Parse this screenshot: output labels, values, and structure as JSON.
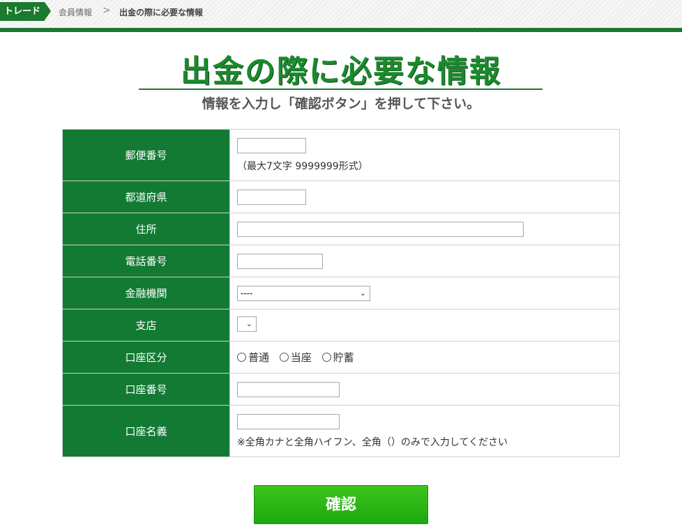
{
  "breadcrumb": {
    "home": "トレード",
    "item1": "会員情報",
    "separator": ">",
    "current": "出金の際に必要な情報"
  },
  "page": {
    "title": "出金の際に必要な情報",
    "subtitle": "情報を入力し「確認ボタン」を押して下さい。"
  },
  "form": {
    "postal_label": "郵便番号",
    "postal_value": "",
    "postal_note": "（最大7文字 9999999形式）",
    "prefecture_label": "都道府県",
    "prefecture_value": "",
    "address_label": "住所",
    "address_value": "",
    "phone_label": "電話番号",
    "phone_value": "",
    "bank_label": "金融機関",
    "bank_selected": "----",
    "branch_label": "支店",
    "branch_selected": "",
    "account_type_label": "口座区分",
    "account_type_options": [
      "普通",
      "当座",
      "貯蓄"
    ],
    "account_number_label": "口座番号",
    "account_number_value": "",
    "account_name_label": "口座名義",
    "account_name_value": "",
    "account_name_note": "※全角カナと全角ハイフン、全角（）のみで入力してください"
  },
  "buttons": {
    "confirm": "確認"
  },
  "colors": {
    "brand_green": "#137a33",
    "title_green": "#1b8a2d",
    "button_green": "#2db516"
  },
  "icons": {
    "select_chevron": "chevron-down-icon",
    "radio": "radio-icon"
  }
}
